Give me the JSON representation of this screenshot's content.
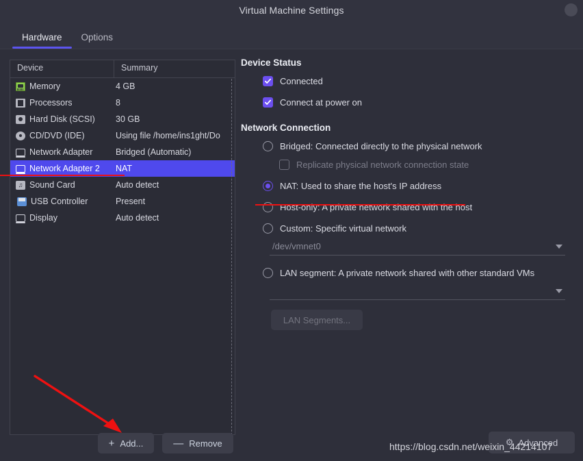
{
  "window": {
    "title": "Virtual Machine Settings",
    "close_icon": "circle-button"
  },
  "tabs": [
    {
      "label": "Hardware",
      "active": true
    },
    {
      "label": "Options",
      "active": false
    }
  ],
  "device_list": {
    "columns": [
      "Device",
      "Summary"
    ],
    "rows": [
      {
        "icon": "memory-icon",
        "device": "Memory",
        "summary": "4 GB",
        "selected": false
      },
      {
        "icon": "processor-icon",
        "device": "Processors",
        "summary": "8",
        "selected": false
      },
      {
        "icon": "harddisk-icon",
        "device": "Hard Disk (SCSI)",
        "summary": "30 GB",
        "selected": false
      },
      {
        "icon": "cddvd-icon",
        "device": "CD/DVD (IDE)",
        "summary": "Using file /home/ins1ght/Do",
        "selected": false
      },
      {
        "icon": "network-icon",
        "device": "Network Adapter",
        "summary": "Bridged (Automatic)",
        "selected": false
      },
      {
        "icon": "network-icon",
        "device": "Network Adapter 2",
        "summary": "NAT",
        "selected": true
      },
      {
        "icon": "soundcard-icon",
        "device": "Sound Card",
        "summary": "Auto detect",
        "selected": false
      },
      {
        "icon": "usb-icon",
        "device": "USB Controller",
        "summary": "Present",
        "selected": false
      },
      {
        "icon": "display-icon",
        "device": "Display",
        "summary": "Auto detect",
        "selected": false
      }
    ]
  },
  "buttons": {
    "add": "Add...",
    "add_symbol": "+",
    "remove": "Remove",
    "remove_symbol": "—",
    "advanced": "Advanced",
    "advanced_icon": "gear-icon"
  },
  "device_status": {
    "title": "Device Status",
    "items": [
      {
        "label": "Connected",
        "checked": true
      },
      {
        "label": "Connect at power on",
        "checked": true
      }
    ]
  },
  "network_connection": {
    "title": "Network Connection",
    "options": [
      {
        "label": "Bridged: Connected directly to the physical network",
        "selected": false
      },
      {
        "label": "NAT: Used to share the host's IP address",
        "selected": true
      },
      {
        "label": "Host-only: A private network shared with the host",
        "selected": false
      },
      {
        "label": "Custom: Specific virtual network",
        "selected": false
      },
      {
        "label": "LAN segment: A private network shared with other standard VMs",
        "selected": false
      }
    ],
    "replicate_label": "Replicate physical network connection state",
    "replicate_checked": false,
    "custom_dropdown_value": "/dev/vmnet0",
    "lan_dropdown_value": "",
    "lan_segments_button": "LAN Segments..."
  },
  "annotations": {
    "arrow_color": "#ef1111",
    "underline_color": "#ef1111"
  },
  "watermark": {
    "text": "https://blog.csdn.net/weixin_44214107"
  },
  "colors": {
    "window_bg": "#2e2f3a",
    "titlebar_bg": "#32333f",
    "accent": "#5c54ef",
    "selection": "#4f49ed",
    "checkbox": "#6c4ff0",
    "annotation_red": "#ef1111"
  }
}
